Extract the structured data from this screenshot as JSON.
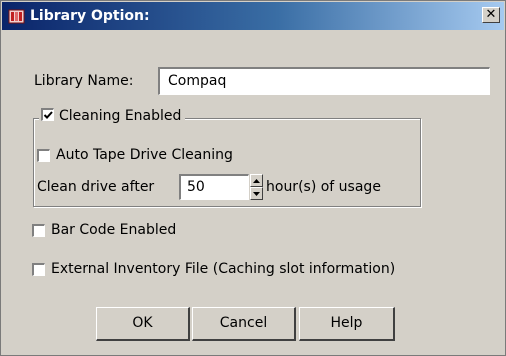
{
  "window": {
    "title": "Library Option:",
    "close_glyph": "✕",
    "title_icon": "library-app-icon"
  },
  "form": {
    "library_name_label": "Library Name:",
    "library_name_value": "Compaq",
    "cleaning_group": {
      "legend": "Cleaning Enabled",
      "cleaning_enabled_checked": true,
      "auto_tape_label": "Auto Tape Drive Cleaning",
      "auto_tape_checked": false,
      "clean_after_label": "Clean drive after",
      "clean_after_value": "50",
      "clean_after_unit": "hour(s) of usage"
    },
    "bar_code_label": "Bar Code Enabled",
    "bar_code_checked": false,
    "external_inventory_label": "External Inventory File (Caching slot information)",
    "external_inventory_checked": false
  },
  "buttons": {
    "ok": "OK",
    "cancel": "Cancel",
    "help": "Help"
  }
}
